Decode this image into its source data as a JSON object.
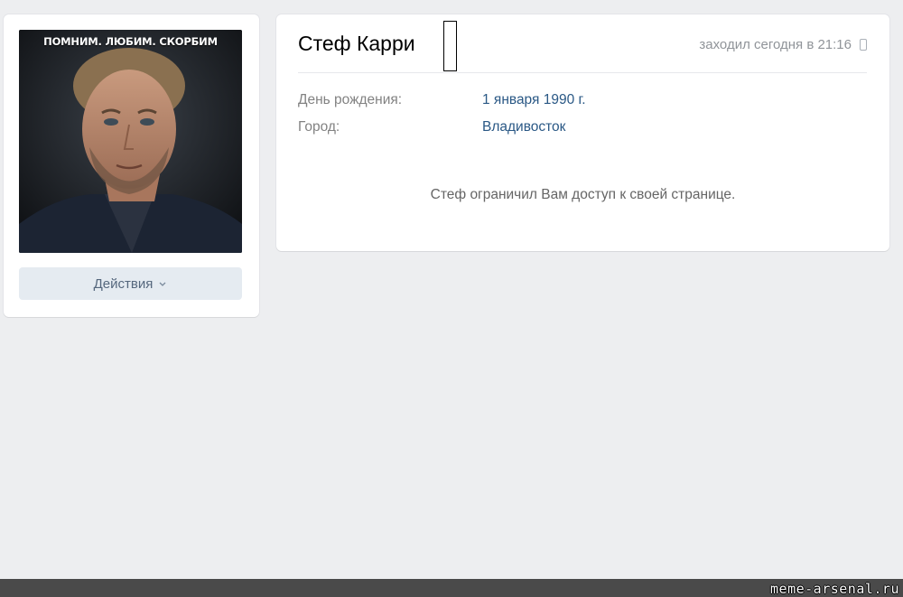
{
  "profile": {
    "name": "Стеф Карри",
    "last_seen": "заходил сегодня в 21:16",
    "last_seen_device_icon": "mobile-phone-icon",
    "avatar_caption": "ПОМНИМ. ЛЮБИМ. СКОРБИМ",
    "actions_label": "Действия",
    "actions_icon": "chevron-down-icon",
    "info": [
      {
        "label": "День рождения:",
        "value": "1 января 1990 г."
      },
      {
        "label": "Город:",
        "value": "Владивосток"
      }
    ],
    "restricted_message": "Стеф ограничил Вам доступ к своей странице."
  },
  "watermark": "meme-arsenal.ru",
  "colors": {
    "background": "#edeef0",
    "card": "#ffffff",
    "link": "#2a5885",
    "button_bg": "#e5ebf1",
    "button_text": "#55677d",
    "muted": "#828282"
  }
}
